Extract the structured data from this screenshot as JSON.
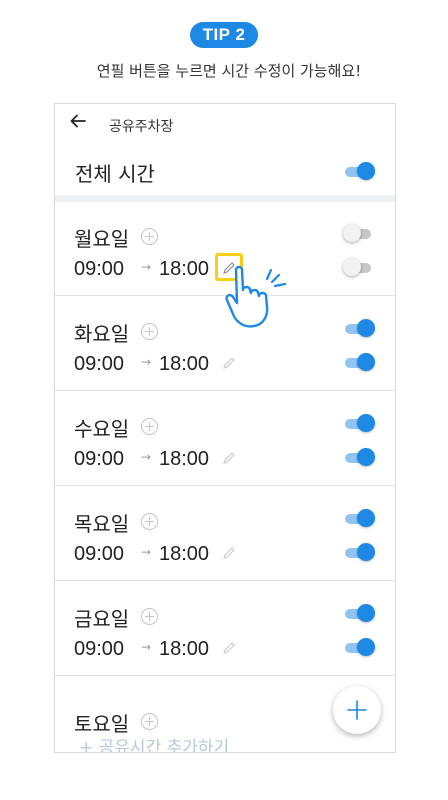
{
  "tip": {
    "badge": "TIP 2",
    "text": "연필 버튼을 누르면 시간 수정이 가능해요!"
  },
  "header": {
    "back_icon": "arrow-left-icon",
    "title": "공유주차장"
  },
  "all_time": {
    "label": "전체 시간",
    "enabled": true
  },
  "days": [
    {
      "name": "월요일",
      "start": "09:00",
      "arrow": "→",
      "end": "18:00",
      "day_enabled": false,
      "time_enabled": false,
      "highlight_edit": true
    },
    {
      "name": "화요일",
      "start": "09:00",
      "arrow": "→",
      "end": "18:00",
      "day_enabled": true,
      "time_enabled": true,
      "highlight_edit": false
    },
    {
      "name": "수요일",
      "start": "09:00",
      "arrow": "→",
      "end": "18:00",
      "day_enabled": true,
      "time_enabled": true,
      "highlight_edit": false
    },
    {
      "name": "목요일",
      "start": "09:00",
      "arrow": "→",
      "end": "18:00",
      "day_enabled": true,
      "time_enabled": true,
      "highlight_edit": false
    },
    {
      "name": "금요일",
      "start": "09:00",
      "arrow": "→",
      "end": "18:00",
      "day_enabled": true,
      "time_enabled": true,
      "highlight_edit": false
    }
  ],
  "saturday": {
    "name": "토요일",
    "add_link": "+ 공유시간 추가하기"
  },
  "colors": {
    "accent": "#1e88e5",
    "highlight": "#f6cf14",
    "toggle_off": "#c6c6c6"
  }
}
